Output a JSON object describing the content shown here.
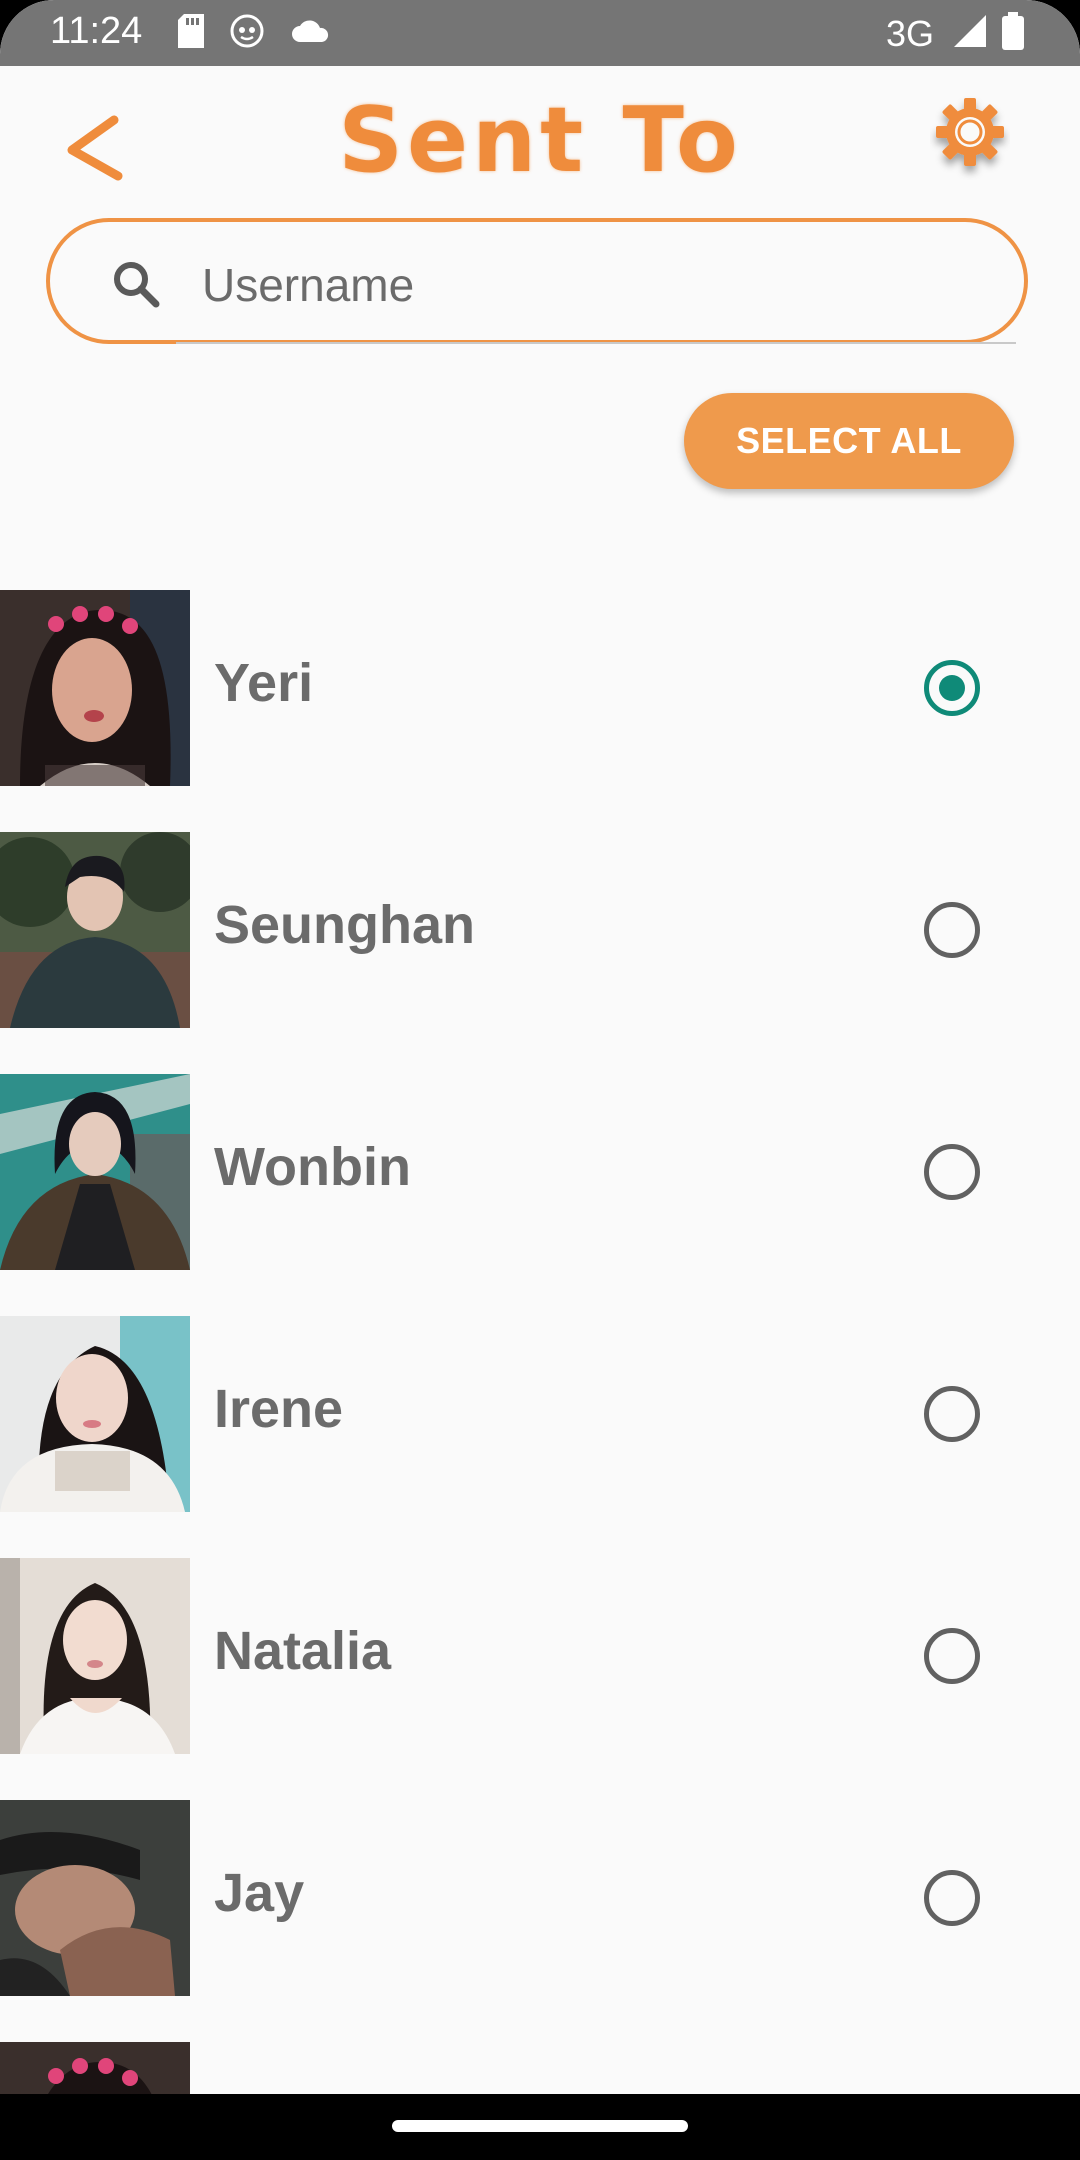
{
  "status_bar": {
    "time": "11:24",
    "network": "3G",
    "left_icons": [
      "sd-card-icon",
      "cat-icon",
      "cloud-icon"
    ],
    "right_icons": [
      "signal-icon",
      "battery-icon"
    ]
  },
  "header": {
    "title": "Sent To",
    "back_icon": "chevron-left-icon",
    "settings_icon": "gear-icon"
  },
  "search": {
    "placeholder": "Username",
    "value": ""
  },
  "select_all_label": "SELECT ALL",
  "colors": {
    "accent": "#ef9345",
    "radio_selected": "#0f8a78",
    "text": "#6b6b6b"
  },
  "contacts": [
    {
      "name": "Yeri",
      "selected": true
    },
    {
      "name": "Seunghan",
      "selected": false
    },
    {
      "name": "Wonbin",
      "selected": false
    },
    {
      "name": "Irene",
      "selected": false
    },
    {
      "name": "Natalia",
      "selected": false
    },
    {
      "name": "Jay",
      "selected": false
    }
  ]
}
